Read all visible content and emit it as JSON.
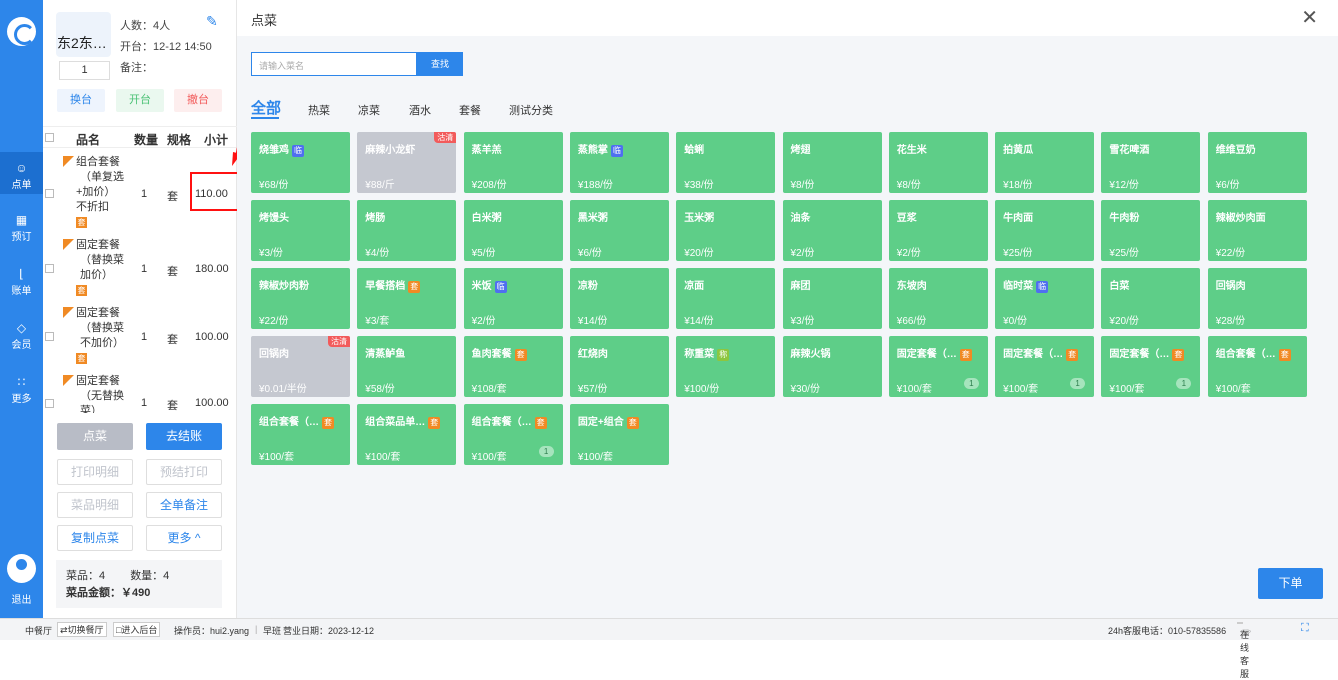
{
  "nav": {
    "items": [
      "点单",
      "预订",
      "账单",
      "会员",
      "更多"
    ],
    "logout": "退出"
  },
  "table": {
    "name": "东2东…",
    "number": "1",
    "people": "人数：4人",
    "open_time": "开台：12-12 14:50",
    "note": "备注：",
    "btn_change": "换台",
    "btn_open": "开台",
    "btn_cancel": "撤台"
  },
  "order_head": {
    "name": "品名",
    "qty": "数量",
    "spec": "规格",
    "subtotal": "小计"
  },
  "order_items": [
    {
      "name": "组合套餐",
      "detail1": "（单复选",
      "detail2": "+加价）",
      "detail3": "不折扣",
      "tag": "套",
      "qty": "1",
      "spec": "套",
      "subtotal": "110.00"
    },
    {
      "name": "固定套餐",
      "detail1": "（替换菜",
      "detail2": "加价）",
      "detail3": "",
      "tag": "套",
      "qty": "1",
      "spec": "套",
      "subtotal": "180.00"
    },
    {
      "name": "固定套餐",
      "detail1": "（替换菜",
      "detail2": "不加价）",
      "detail3": "",
      "tag": "套",
      "qty": "1",
      "spec": "套",
      "subtotal": "100.00"
    },
    {
      "name": "固定套餐",
      "detail1": "（无替换",
      "detail2": "菜）",
      "detail3": "",
      "tag": "",
      "qty": "1",
      "spec": "套",
      "subtotal": "100.00"
    }
  ],
  "actions": {
    "order": "点菜",
    "checkout": "去结账",
    "print_detail": "打印明细",
    "pre_print": "预结打印",
    "dish_detail": "菜品明细",
    "all_note": "全单备注",
    "copy": "复制点菜",
    "more": "更多 ^"
  },
  "summary": {
    "dishes": "菜品：4",
    "count": "数量：4",
    "amount": "菜品金额：￥490"
  },
  "main": {
    "title": "点菜",
    "close": "✕",
    "search_placeholder": "请输入菜名",
    "search_btn": "查找",
    "order_btn": "下单"
  },
  "categories": [
    "全部",
    "热菜",
    "凉菜",
    "酒水",
    "套餐",
    "测试分类"
  ],
  "dishes": [
    {
      "name": "烧雏鸡",
      "badge": "临",
      "price": "¥68/份"
    },
    {
      "name": "麻辣小龙虾",
      "badge": "",
      "price": "¥88/斤",
      "off": true,
      "gq": "沽清"
    },
    {
      "name": "蒸羊羔",
      "badge": "",
      "price": "¥208/份"
    },
    {
      "name": "蒸熊掌",
      "badge": "临",
      "price": "¥188/份"
    },
    {
      "name": "蛤蜊",
      "badge": "",
      "price": "¥38/份"
    },
    {
      "name": "烤翅",
      "badge": "",
      "price": "¥8/份"
    },
    {
      "name": "花生米",
      "badge": "",
      "price": "¥8/份"
    },
    {
      "name": "拍黄瓜",
      "badge": "",
      "price": "¥18/份"
    },
    {
      "name": "雪花啤酒",
      "badge": "",
      "price": "¥12/份"
    },
    {
      "name": "维维豆奶",
      "badge": "",
      "price": "¥6/份"
    },
    {
      "name": "烤馒头",
      "badge": "",
      "price": "¥3/份"
    },
    {
      "name": "烤肠",
      "badge": "",
      "price": "¥4/份"
    },
    {
      "name": "白米粥",
      "badge": "",
      "price": "¥5/份"
    },
    {
      "name": "黑米粥",
      "badge": "",
      "price": "¥6/份"
    },
    {
      "name": "玉米粥",
      "badge": "",
      "price": "¥20/份"
    },
    {
      "name": "油条",
      "badge": "",
      "price": "¥2/份"
    },
    {
      "name": "豆浆",
      "badge": "",
      "price": "¥2/份"
    },
    {
      "name": "牛肉面",
      "badge": "",
      "price": "¥25/份"
    },
    {
      "name": "牛肉粉",
      "badge": "",
      "price": "¥25/份"
    },
    {
      "name": "辣椒炒肉面",
      "badge": "",
      "price": "¥22/份"
    },
    {
      "name": "辣椒炒肉粉",
      "badge": "",
      "price": "¥22/份"
    },
    {
      "name": "早餐搭档",
      "badge": "套",
      "price": "¥3/套"
    },
    {
      "name": "米饭",
      "badge": "临",
      "price": "¥2/份"
    },
    {
      "name": "凉粉",
      "badge": "",
      "price": "¥14/份"
    },
    {
      "name": "凉面",
      "badge": "",
      "price": "¥14/份"
    },
    {
      "name": "麻团",
      "badge": "",
      "price": "¥3/份"
    },
    {
      "name": "东坡肉",
      "badge": "",
      "price": "¥66/份"
    },
    {
      "name": "临时菜",
      "badge": "临",
      "price": "¥0/份"
    },
    {
      "name": "白菜",
      "badge": "",
      "price": "¥20/份"
    },
    {
      "name": "回锅肉",
      "badge": "",
      "price": "¥28/份"
    },
    {
      "name": "回锅肉",
      "badge": "",
      "price": "¥0.01/半份",
      "off": true,
      "gq": "沽清"
    },
    {
      "name": "清蒸鲈鱼",
      "badge": "",
      "price": "¥58/份"
    },
    {
      "name": "鱼肉套餐",
      "badge": "套",
      "price": "¥108/套"
    },
    {
      "name": "红烧肉",
      "badge": "",
      "price": "¥57/份"
    },
    {
      "name": "称重菜",
      "badge": "称",
      "price": "¥100/份"
    },
    {
      "name": "麻辣火锅",
      "badge": "",
      "price": "¥30/份"
    },
    {
      "name": "固定套餐（…",
      "badge": "套",
      "price": "¥100/套",
      "qty": "1"
    },
    {
      "name": "固定套餐（…",
      "badge": "套",
      "price": "¥100/套",
      "qty": "1"
    },
    {
      "name": "固定套餐（…",
      "badge": "套",
      "price": "¥100/套",
      "qty": "1"
    },
    {
      "name": "组合套餐（…",
      "badge": "套",
      "price": "¥100/套"
    },
    {
      "name": "组合套餐（…",
      "badge": "套",
      "price": "¥100/套"
    },
    {
      "name": "组合菜品单…",
      "badge": "套",
      "price": "¥100/套"
    },
    {
      "name": "组合套餐（…",
      "badge": "套",
      "price": "¥100/套",
      "qty": "1"
    },
    {
      "name": "固定+组合",
      "badge": "套",
      "price": "¥100/套"
    }
  ],
  "status": {
    "room": "中餐厅",
    "switch": "⇄切换餐厅",
    "backend": "□进入后台",
    "operator": "操作员：hui2.yang",
    "shift": "早班",
    "biz_date": "营业日期：2023-12-12",
    "phone": "24h客服电话：010-57835586",
    "online": "在线客服"
  },
  "colors": {
    "primary": "#2d86ea",
    "dish_green": "#5ece88",
    "dish_off": "#c5c8d0",
    "badge_temp": "#4f6ff0",
    "badge_set": "#f08a24",
    "badge_weigh": "#8dc63f",
    "highlight": "#ff1111"
  }
}
